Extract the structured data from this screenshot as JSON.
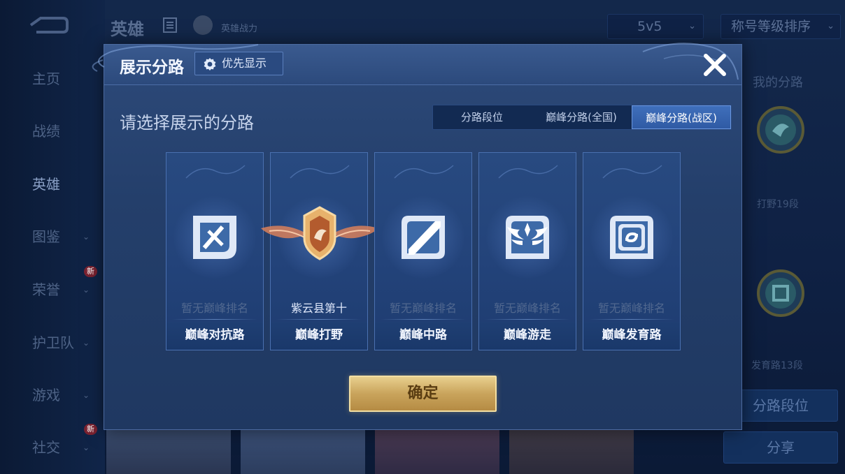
{
  "background": {
    "top_title": "英雄",
    "power_label": "英雄战力",
    "mode_select": "5v5",
    "sort_select": "称号等级排序",
    "nav_items": [
      {
        "label": "主页"
      },
      {
        "label": "战绩"
      },
      {
        "label": "英雄"
      },
      {
        "label": "图鉴"
      },
      {
        "label": "荣誉",
        "badge": "新"
      },
      {
        "label": "护卫队"
      },
      {
        "label": "游戏"
      },
      {
        "label": "社交",
        "badge": "新"
      }
    ],
    "right_panel": {
      "title": "我的分路",
      "lane1_label": "打野19段",
      "lane2_label": "发育路13段",
      "lane_rank_button": "分路段位",
      "share_button": "分享"
    }
  },
  "modal": {
    "title": "展示分路",
    "priority_button": "优先显示",
    "subtitle": "请选择展示的分路",
    "tabs": [
      {
        "label": "分路段位",
        "selected": false
      },
      {
        "label": "巅峰分路(全国)",
        "selected": false
      },
      {
        "label": "巅峰分路(战区)",
        "selected": true
      }
    ],
    "cards": [
      {
        "rank": "暂无巅峰排名",
        "lane": "巅峰对抗路",
        "icon": "clash-lane-icon"
      },
      {
        "rank": "紫云县第十",
        "lane": "巅峰打野",
        "icon": "jungle-gold-badge-icon"
      },
      {
        "rank": "暂无巅峰排名",
        "lane": "巅峰中路",
        "icon": "mid-lane-icon"
      },
      {
        "rank": "暂无巅峰排名",
        "lane": "巅峰游走",
        "icon": "roam-wings-icon"
      },
      {
        "rank": "暂无巅峰排名",
        "lane": "巅峰发育路",
        "icon": "farm-lane-icon"
      }
    ],
    "confirm_button": "确定"
  },
  "colors": {
    "modal_bg": "#2a4775",
    "selected_tab": "#3a66b0",
    "confirm_gold": "#d4b06a"
  }
}
